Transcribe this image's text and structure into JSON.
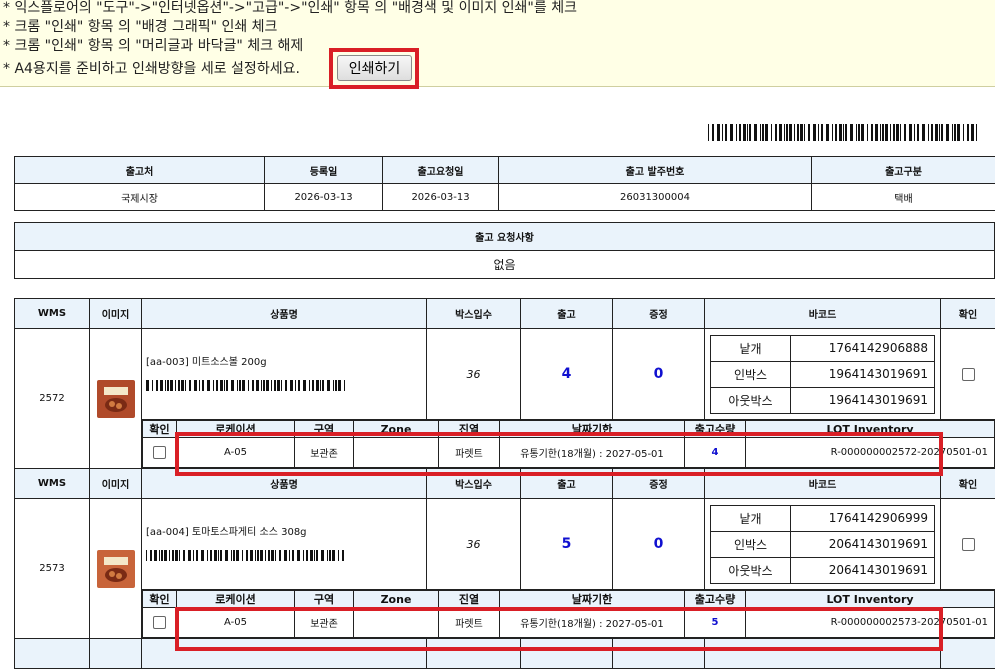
{
  "notice": {
    "line1": "* 익스플로어의 \"도구\"->\"인터넷옵션\"->\"고급\"->\"인쇄\" 항목 의 \"배경색 및 이미지 인쇄\"를 체크",
    "line2": "* 크롬 \"인쇄\" 항목 의 \"배경 그래픽\" 인쇄 체크",
    "line3": "* 크롬 \"인쇄\" 항목 의 \"머리글과 바닥글\" 체크 해제",
    "line4": "* A4용지를 준비하고 인쇄방향을 세로 설정하세요.",
    "print_button": "인쇄하기"
  },
  "order": {
    "headers": [
      "출고처",
      "등록일",
      "출고요청일",
      "출고 발주번호",
      "출고구분"
    ],
    "values": [
      "국제시장",
      "2026-03-13",
      "2026-03-13",
      "26031300004",
      "택배"
    ]
  },
  "request": {
    "header": "출고 요청사항",
    "value": "없음"
  },
  "item_headers": [
    "WMS",
    "이미지",
    "상품명",
    "박스입수",
    "출고",
    "증정",
    "바코드",
    "확인"
  ],
  "sub_headers": [
    "확인",
    "로케이션",
    "구역",
    "Zone",
    "진열",
    "날짜기한",
    "출고수량",
    "LOT Inventory"
  ],
  "items": [
    {
      "wms": "2572",
      "name": "[aa-003] 미트소스볼 200g",
      "box_qty": "36",
      "out": "4",
      "bonus": "0",
      "barcodes": [
        {
          "label": "낱개",
          "value": "1764142906888"
        },
        {
          "label": "인박스",
          "value": "1964143019691"
        },
        {
          "label": "아웃박스",
          "value": "1964143019691"
        }
      ],
      "img_color": "#b04a2a",
      "loc": {
        "location": "A-05",
        "area": "보관존",
        "zone": "",
        "display": "파렛트",
        "expiry": "유통기한(18개월) : 2027-05-01",
        "qty": "4",
        "lot": "R-000000002572-20270501-01"
      }
    },
    {
      "wms": "2573",
      "name": "[aa-004] 토마토스파게티 소스 308g",
      "box_qty": "36",
      "out": "5",
      "bonus": "0",
      "barcodes": [
        {
          "label": "낱개",
          "value": "1764142906999"
        },
        {
          "label": "인박스",
          "value": "2064143019691"
        },
        {
          "label": "아웃박스",
          "value": "2064143019691"
        }
      ],
      "img_color": "#c8643a",
      "loc": {
        "location": "A-05",
        "area": "보관존",
        "zone": "",
        "display": "파렛트",
        "expiry": "유통기한(18개월) : 2027-05-01",
        "qty": "5",
        "lot": "R-000000002573-20270501-01"
      }
    }
  ],
  "colors": {
    "highlight": "#d91f26",
    "header_bg": "#eaf3fb",
    "notice_bg": "#ffffe6",
    "qty_blue": "#1010d0"
  }
}
